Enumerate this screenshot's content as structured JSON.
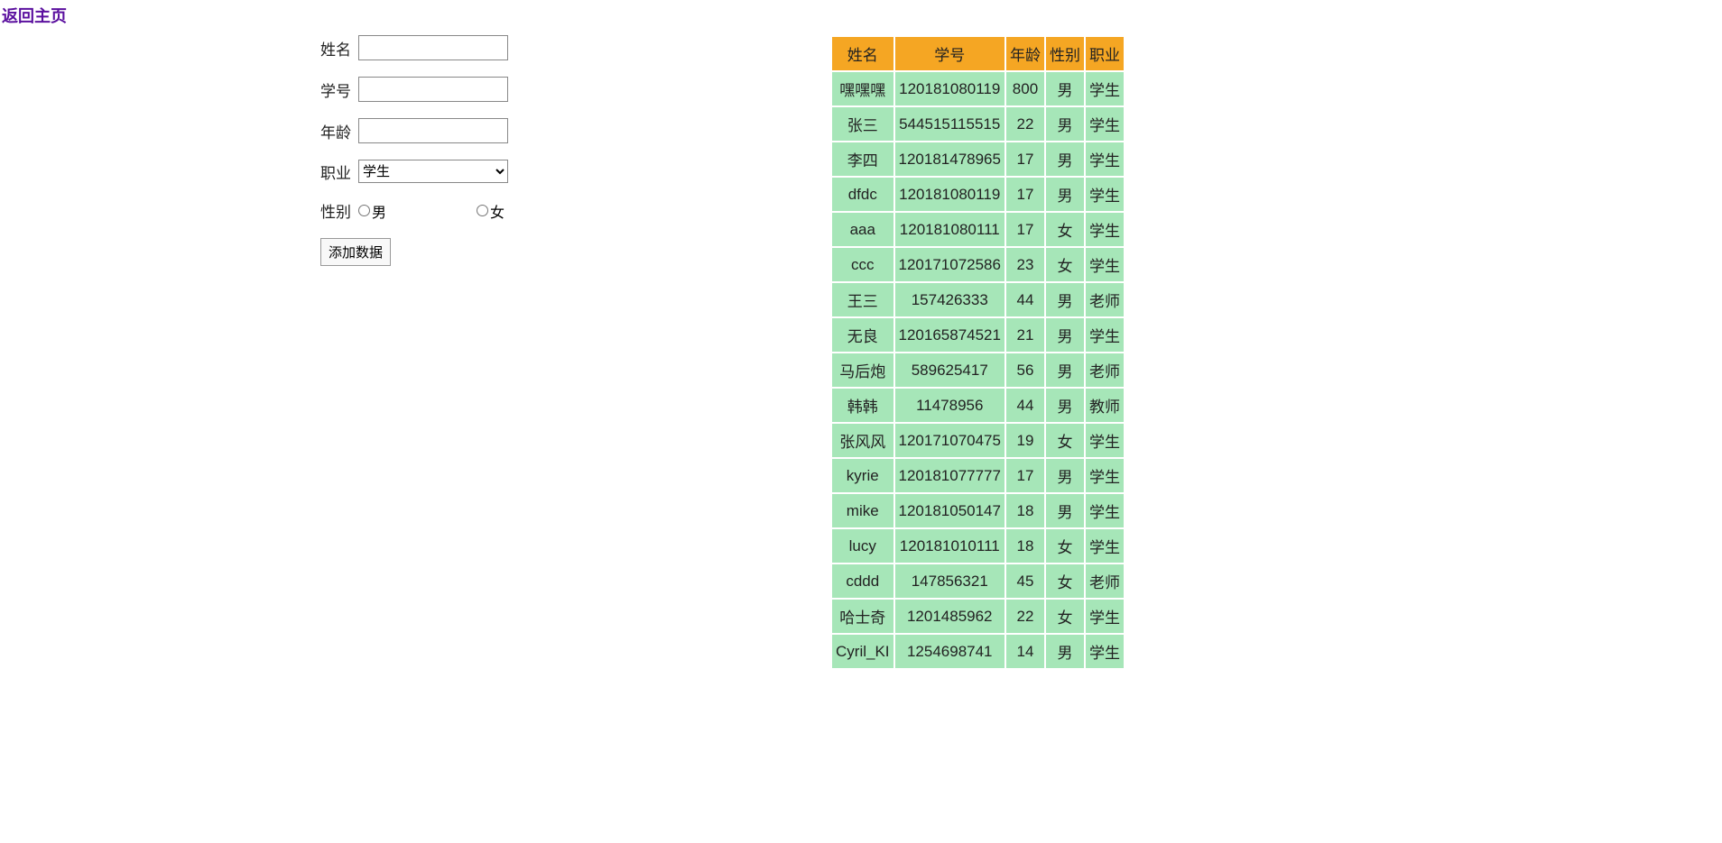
{
  "nav": {
    "back_link": "返回主页"
  },
  "form": {
    "name_label": "姓名",
    "id_label": "学号",
    "age_label": "年龄",
    "job_label": "职业",
    "gender_label": "性别",
    "job_selected": "学生",
    "gender_male": "男",
    "gender_female": "女",
    "submit_label": "添加数据"
  },
  "table": {
    "headers": [
      "姓名",
      "学号",
      "年龄",
      "性别",
      "职业"
    ],
    "rows": [
      {
        "name": "嘿嘿嘿",
        "id": "120181080119",
        "age": "800",
        "gender": "男",
        "job": "学生"
      },
      {
        "name": "张三",
        "id": "544515115515",
        "age": "22",
        "gender": "男",
        "job": "学生"
      },
      {
        "name": "李四",
        "id": "120181478965",
        "age": "17",
        "gender": "男",
        "job": "学生"
      },
      {
        "name": "dfdc",
        "id": "120181080119",
        "age": "17",
        "gender": "男",
        "job": "学生"
      },
      {
        "name": "aaa",
        "id": "120181080111",
        "age": "17",
        "gender": "女",
        "job": "学生"
      },
      {
        "name": "ccc",
        "id": "120171072586",
        "age": "23",
        "gender": "女",
        "job": "学生"
      },
      {
        "name": "王三",
        "id": "157426333",
        "age": "44",
        "gender": "男",
        "job": "老师"
      },
      {
        "name": "无良",
        "id": "120165874521",
        "age": "21",
        "gender": "男",
        "job": "学生"
      },
      {
        "name": "马后炮",
        "id": "589625417",
        "age": "56",
        "gender": "男",
        "job": "老师"
      },
      {
        "name": "韩韩",
        "id": "11478956",
        "age": "44",
        "gender": "男",
        "job": "教师"
      },
      {
        "name": "张风风",
        "id": "120171070475",
        "age": "19",
        "gender": "女",
        "job": "学生"
      },
      {
        "name": "kyrie",
        "id": "120181077777",
        "age": "17",
        "gender": "男",
        "job": "学生"
      },
      {
        "name": "mike",
        "id": "120181050147",
        "age": "18",
        "gender": "男",
        "job": "学生"
      },
      {
        "name": "lucy",
        "id": "120181010111",
        "age": "18",
        "gender": "女",
        "job": "学生"
      },
      {
        "name": "cddd",
        "id": "147856321",
        "age": "45",
        "gender": "女",
        "job": "老师"
      },
      {
        "name": "哈士奇",
        "id": "1201485962",
        "age": "22",
        "gender": "女",
        "job": "学生"
      },
      {
        "name": "Cyril_KI",
        "id": "1254698741",
        "age": "14",
        "gender": "男",
        "job": "学生"
      }
    ]
  }
}
